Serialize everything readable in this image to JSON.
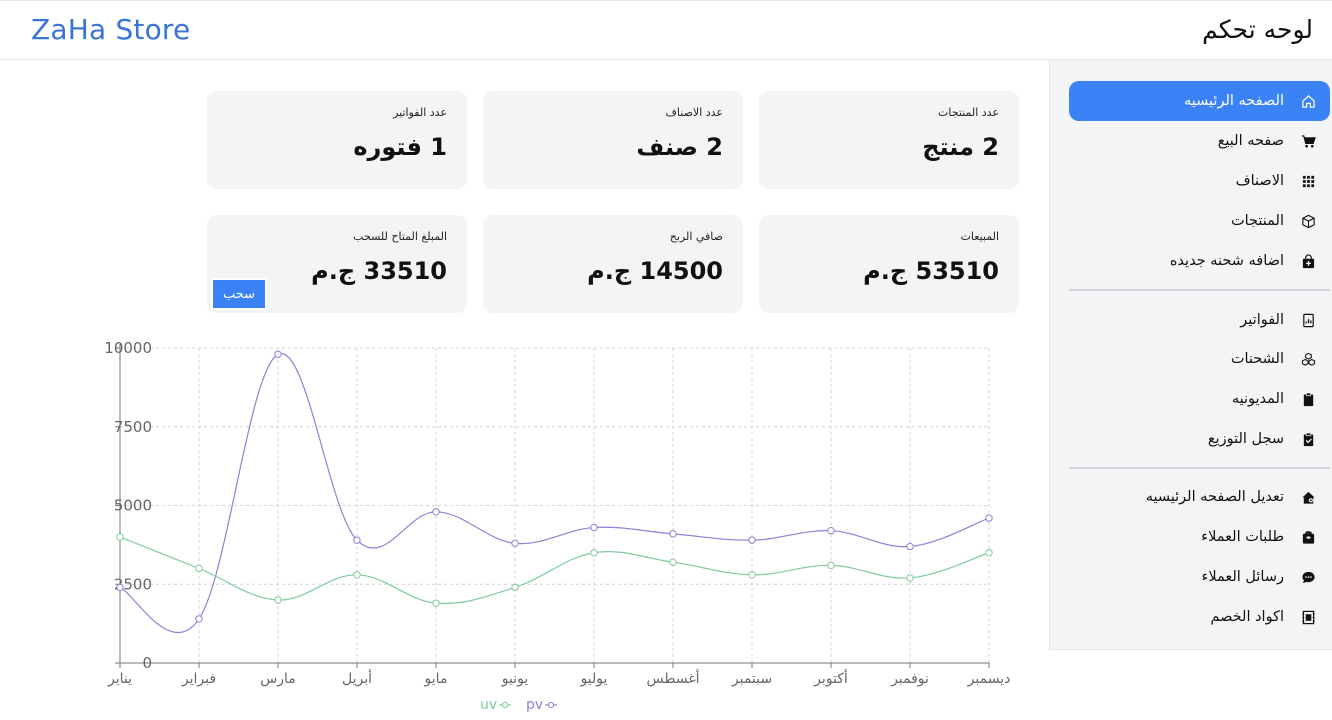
{
  "header": {
    "brand": "ZaHa Store",
    "title": "لوحه تحكم"
  },
  "sidebar": {
    "items": [
      {
        "label": "الصفحه الرئيسيه",
        "icon": "home-icon",
        "active": true
      },
      {
        "label": "صفحه البيع",
        "icon": "cart-icon",
        "active": false
      },
      {
        "label": "الاصناف",
        "icon": "grid-icon",
        "active": false
      },
      {
        "label": "المنتجات",
        "icon": "box-icon",
        "active": false
      },
      {
        "label": "اضافه شحنه جديده",
        "icon": "bag-plus-icon",
        "active": false
      },
      {
        "label": "الفواتير",
        "icon": "invoice-icon",
        "active": false
      },
      {
        "label": "الشحنات",
        "icon": "boxes-icon",
        "active": false
      },
      {
        "label": "المديونيه",
        "icon": "clipboard-icon",
        "active": false
      },
      {
        "label": "سجل التوزيع",
        "icon": "clipboard-check-icon",
        "active": false
      },
      {
        "label": "تعديل الصفحه الرئيسيه",
        "icon": "house-gear-icon",
        "active": false
      },
      {
        "label": "طلبات العملاء",
        "icon": "inbox-box-icon",
        "active": false
      },
      {
        "label": "رسائل العملاء",
        "icon": "chat-icon",
        "active": false
      },
      {
        "label": "اكواد الخصم",
        "icon": "coupon-icon",
        "active": false
      }
    ],
    "accent": "#3b82f6"
  },
  "stats": {
    "products": {
      "label": "عدد المنتجات",
      "value": "2 منتج"
    },
    "categories": {
      "label": "عدد الاصناف",
      "value": "2 صنف"
    },
    "invoices": {
      "label": "عدد الفواتير",
      "value": "1 فتوره"
    },
    "sales": {
      "label": "المبيعات",
      "value": "53510 ج.م"
    },
    "profit": {
      "label": "صافي الربح",
      "value": "14500 ج.م"
    },
    "available": {
      "label": "المبلغ المتاح للسحب",
      "value": "33510 ج.م",
      "button": "سحب"
    }
  },
  "chart_data": {
    "type": "line",
    "categories": [
      "يناير",
      "فبراير",
      "مارس",
      "أبريل",
      "مايو",
      "يونيو",
      "يوليو",
      "أغسطس",
      "سبتمبر",
      "أكتوبر",
      "نوفمبر",
      "ديسمبر"
    ],
    "series": [
      {
        "name": "pv",
        "color": "#8884d8",
        "values": [
          2400,
          1400,
          9800,
          3900,
          4800,
          3800,
          4300,
          4100,
          3900,
          4200,
          3700,
          4600
        ]
      },
      {
        "name": "uv",
        "color": "#82ca9d",
        "values": [
          4000,
          3000,
          2000,
          2800,
          1900,
          2400,
          3500,
          3200,
          2800,
          3100,
          2700,
          3500
        ]
      }
    ],
    "yticks": [
      "0",
      "2500",
      "5000",
      "7500",
      "10000"
    ],
    "ylim": [
      0,
      10000
    ],
    "grid": true,
    "legend": "bottom-center"
  }
}
